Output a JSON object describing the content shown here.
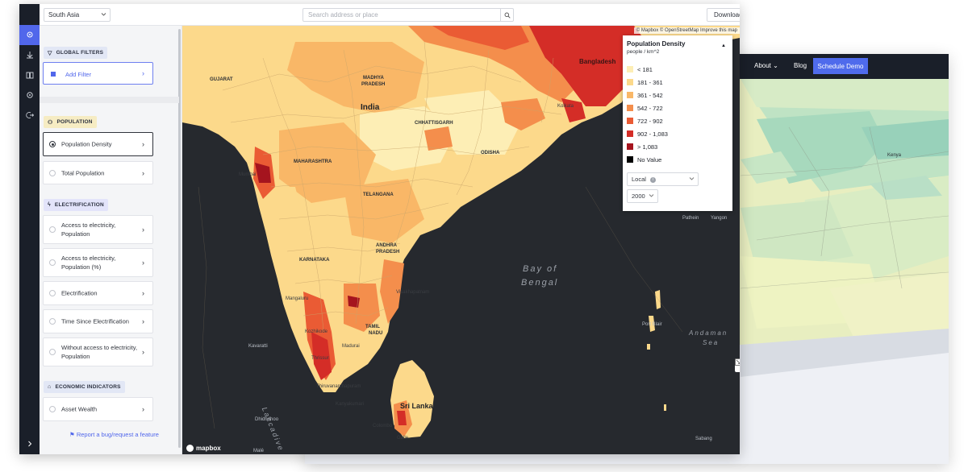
{
  "background_site": {
    "nav": {
      "about": "About",
      "blog": "Blog",
      "schedule_demo": "Schedule Demo"
    },
    "labels": {
      "kenya": "Kenya"
    }
  },
  "topbar": {
    "region": "South Asia",
    "search_placeholder": "Search address or place",
    "download": "Download"
  },
  "sidebar_icons": [
    "map-pin-icon",
    "download-icon",
    "book-icon",
    "gear-icon",
    "logout-icon",
    "expand-icon"
  ],
  "panel": {
    "global_filters": "GLOBAL FILTERS",
    "add_filter": "Add Filter",
    "sections": [
      {
        "title": "POPULATION",
        "items": [
          "Population Density",
          "Total Population"
        ]
      },
      {
        "title": "ELECTRIFICATION",
        "items": [
          "Access to electricity, Population",
          "Access to electricity, Population (%)",
          "Electrification",
          "Time Since Electrification",
          "Without access to electricity, Population"
        ]
      },
      {
        "title": "ECONOMIC INDICATORS",
        "items": [
          "Asset Wealth"
        ]
      }
    ],
    "selected_item": "Population Density",
    "report_link": "Report a bug/request a feature"
  },
  "map": {
    "attribution": "© Mapbox © OpenStreetMap  Improve this map",
    "logo": "mapbox",
    "seas": {
      "bay": "Bay of",
      "bengal": "Bengal",
      "andaman": "Andaman",
      "andaman_sea": "Sea",
      "laccadive": "Laccadive Sea"
    },
    "labels": {
      "india": "India",
      "gujarat": "GUJARAT",
      "madhya": "MADHYA",
      "pradesh": "PRADESH",
      "chhattisgarh": "CHHATTISGARH",
      "odisha": "ODISHA",
      "maharashtra": "MAHARASHTRA",
      "telangana": "TELANGANA",
      "andhra": "ANDHRA",
      "andhra_pradesh": "PRADESH",
      "karnataka": "KARNATAKA",
      "tamil": "TAMIL",
      "nadu": "NADU",
      "sri_lanka": "Sri Lanka",
      "bangladesh": "Bangladesh"
    },
    "cities": {
      "mumbai": "Mumbai",
      "kolkata": "Kolkata",
      "kanyakumari": "Kanyakumari",
      "thiruvananthapuram": "Thiruvananthapuram",
      "colombo": "Colombo",
      "galle": "Galle",
      "kavaratti": "Kavaratti",
      "dhidhdhoo": "Dhidhdhoo",
      "male": "Malé",
      "pathein": "Pathein",
      "yangon": "Yangon",
      "sabang": "Sabang",
      "port_blair": "Port Blair",
      "visakhapatnam": "Visakhapatnam",
      "mangaluru": "Mangaluru",
      "kozhikode": "Kozhikode",
      "thrissur": "Thrissur",
      "madurai": "Madurai"
    }
  },
  "legend": {
    "title": "Population Density",
    "unit": "people / km^2",
    "items": [
      {
        "label": "< 181",
        "color": "#fdeeb5"
      },
      {
        "label": "181 - 361",
        "color": "#fcd98b"
      },
      {
        "label": "361 - 542",
        "color": "#f9b767"
      },
      {
        "label": "542 - 722",
        "color": "#f48e4c"
      },
      {
        "label": "722 - 902",
        "color": "#ea5b34"
      },
      {
        "label": "902 - 1,083",
        "color": "#d42d27"
      },
      {
        "label": "> 1,083",
        "color": "#a5141e"
      },
      {
        "label": "No Value",
        "color": "#000000"
      }
    ],
    "scale_select": "Local",
    "year_select": "2000"
  }
}
